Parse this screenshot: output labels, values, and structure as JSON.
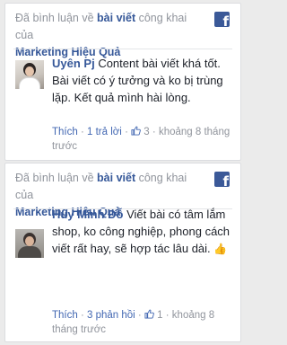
{
  "comments": [
    {
      "header": {
        "prefix": "Đã bình luận về",
        "post_link": "bài viết",
        "suffix": "công khai của",
        "page_name": "Marketing Hiệu Quả"
      },
      "author": "Uyên Pj",
      "text": "Content bài viết khá tốt. Bài viết có ý tưởng và ko bị trùng lặp. Kết quả mình hài lòng.",
      "emoji": "",
      "like_label": "Thích",
      "replies": "1 trả lời",
      "like_count": "3",
      "time": "khoảng 8 tháng trước",
      "fb_icon": "facebook-icon",
      "avatar_icon": "user-photo-icon"
    },
    {
      "header": {
        "prefix": "Đã bình luận về",
        "post_link": "bài viết",
        "suffix": "công khai của",
        "page_name": "Marketing Hiệu Quả"
      },
      "author": "Huy Minh Đỗ",
      "text": "Viết bài có tâm lắm shop, ko công nghiệp, phong cách viết rất hay, sẽ hợp tác lâu dài.",
      "emoji": "👍",
      "like_label": "Thích",
      "replies": "3 phản hồi",
      "like_count": "1",
      "time": "khoảng 8 tháng trước",
      "fb_icon": "facebook-icon",
      "avatar_icon": "user-photo-icon"
    }
  ],
  "colors": {
    "link": "#365899",
    "meta": "#90949c",
    "facebook_blue": "#3b5998"
  }
}
